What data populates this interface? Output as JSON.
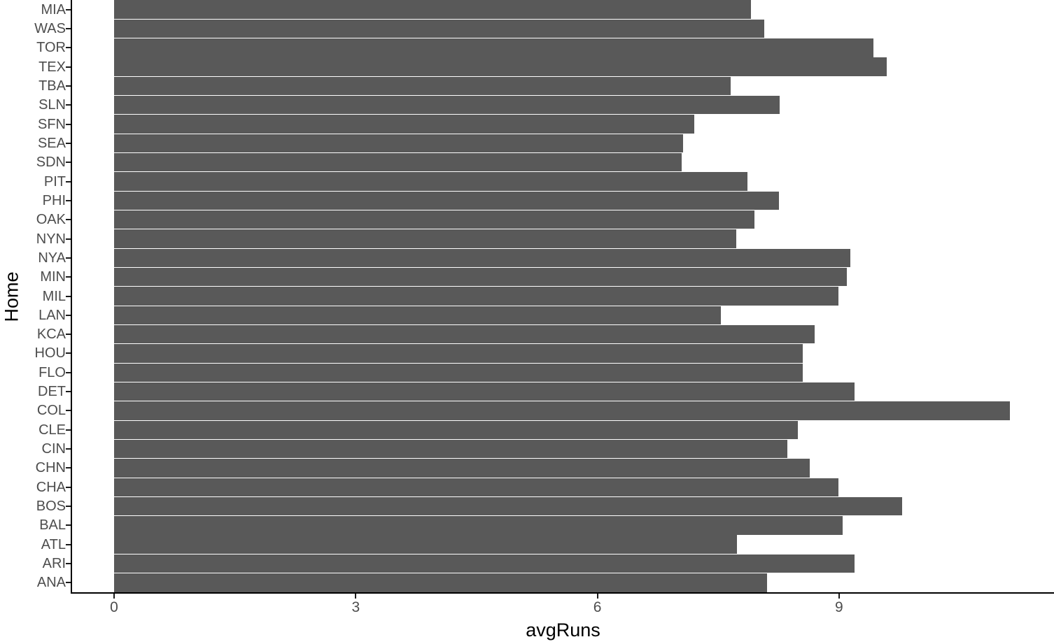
{
  "chart_data": {
    "type": "bar",
    "orientation": "horizontal",
    "title": "",
    "subtitle": "",
    "xlabel": "avgRuns",
    "ylabel": "Home",
    "xlim": [
      0,
      11.9
    ],
    "ylim": null,
    "grid": false,
    "legend": null,
    "bar_color": "#595959",
    "background_color": "#ffffff",
    "axis_color": "#000000",
    "tick_label_color": "#4d4d4d",
    "x_ticks": [
      0,
      3,
      6,
      9
    ],
    "x_tick_labels": [
      "0",
      "3",
      "6",
      "9"
    ],
    "categories": [
      "MIA",
      "WAS",
      "TOR",
      "TEX",
      "TBA",
      "SLN",
      "SFN",
      "SEA",
      "SDN",
      "PIT",
      "PHI",
      "OAK",
      "NYN",
      "NYA",
      "MIN",
      "MIL",
      "LAN",
      "KCA",
      "HOU",
      "FLO",
      "DET",
      "COL",
      "CLE",
      "CIN",
      "CHN",
      "CHA",
      "BOS",
      "BAL",
      "ATL",
      "ARI",
      "ANA"
    ],
    "values": [
      7.91,
      8.07,
      9.43,
      9.59,
      7.65,
      8.26,
      7.2,
      7.06,
      7.05,
      7.86,
      8.25,
      7.95,
      7.72,
      9.14,
      9.1,
      8.99,
      7.53,
      8.7,
      8.55,
      8.55,
      9.19,
      11.12,
      8.49,
      8.36,
      8.64,
      8.99,
      9.78,
      9.04,
      7.73,
      9.19,
      8.11
    ],
    "points": [
      {
        "category": "MIA",
        "value": 7.91
      },
      {
        "category": "WAS",
        "value": 8.07
      },
      {
        "category": "TOR",
        "value": 9.43
      },
      {
        "category": "TEX",
        "value": 9.59
      },
      {
        "category": "TBA",
        "value": 7.65
      },
      {
        "category": "SLN",
        "value": 8.26
      },
      {
        "category": "SFN",
        "value": 7.2
      },
      {
        "category": "SEA",
        "value": 7.06
      },
      {
        "category": "SDN",
        "value": 7.05
      },
      {
        "category": "PIT",
        "value": 7.86
      },
      {
        "category": "PHI",
        "value": 8.25
      },
      {
        "category": "OAK",
        "value": 7.95
      },
      {
        "category": "NYN",
        "value": 7.72
      },
      {
        "category": "NYA",
        "value": 9.14
      },
      {
        "category": "MIN",
        "value": 9.1
      },
      {
        "category": "MIL",
        "value": 8.99
      },
      {
        "category": "LAN",
        "value": 7.53
      },
      {
        "category": "KCA",
        "value": 8.7
      },
      {
        "category": "HOU",
        "value": 8.55
      },
      {
        "category": "FLO",
        "value": 8.55
      },
      {
        "category": "DET",
        "value": 9.19
      },
      {
        "category": "COL",
        "value": 11.12
      },
      {
        "category": "CLE",
        "value": 8.49
      },
      {
        "category": "CIN",
        "value": 8.36
      },
      {
        "category": "CHN",
        "value": 8.64
      },
      {
        "category": "CHA",
        "value": 8.99
      },
      {
        "category": "BOS",
        "value": 9.78
      },
      {
        "category": "BAL",
        "value": 9.04
      },
      {
        "category": "ATL",
        "value": 7.73
      },
      {
        "category": "ARI",
        "value": 9.19
      },
      {
        "category": "ANA",
        "value": 8.11
      }
    ]
  }
}
